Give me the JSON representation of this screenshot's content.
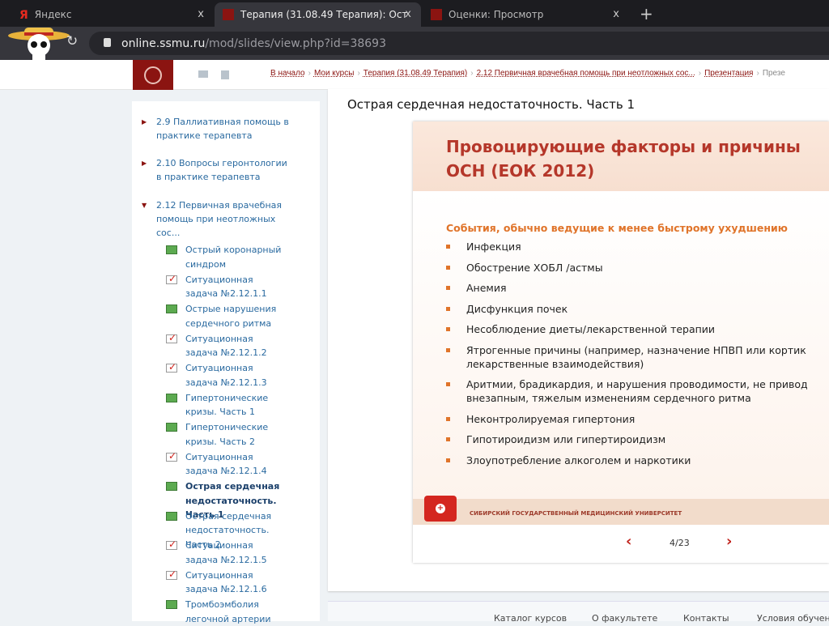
{
  "browser": {
    "tabs": [
      {
        "label": "Яндекс",
        "active": false,
        "icon": "yandex-icon"
      },
      {
        "label": "Терапия (31.08.49 Терапия): Ост",
        "active": true,
        "icon": "ssmu-icon"
      },
      {
        "label": "Оценки: Просмотр",
        "active": false,
        "icon": "ssmu-icon"
      }
    ],
    "close_glyph": "x",
    "new_tab": "+",
    "url_host": "online.ssmu.ru",
    "url_path": "/mod/slides/view.php?id=38693"
  },
  "breadcrumbs": [
    "В начало",
    "Мои курсы",
    "Терапия (31.08.49 Терапия)",
    "2.12 Первичная врачебная помощь при неотложных сос...",
    "Презентация",
    "Презе"
  ],
  "sidebar": {
    "sections": [
      {
        "label": "2.9 Паллиативная помощь в практике терапевта",
        "expanded": false
      },
      {
        "label": "2.10 Вопросы геронтологии в практике терапевта",
        "expanded": false
      },
      {
        "label": "2.12 Первичная врачебная помощь при неотложных сос...",
        "expanded": true
      }
    ],
    "items": [
      {
        "label": "Острый коронарный синдром",
        "type": "slides"
      },
      {
        "label": "Ситуационная задача №2.12.1.1",
        "type": "task"
      },
      {
        "label": "Острые нарушения сердечного ритма",
        "type": "slides"
      },
      {
        "label": "Ситуационная задача №2.12.1.2",
        "type": "task"
      },
      {
        "label": "Ситуационная задача №2.12.1.3",
        "type": "task"
      },
      {
        "label": "Гипертонические кризы. Часть 1",
        "type": "slides"
      },
      {
        "label": "Гипертонические кризы. Часть 2",
        "type": "slides"
      },
      {
        "label": "Ситуационная задача №2.12.1.4",
        "type": "task"
      },
      {
        "label": "Острая сердечная недостаточность. Часть 1",
        "type": "slides",
        "current": true
      },
      {
        "label": "Острая сердечная недостаточность. Часть 2",
        "type": "slides"
      },
      {
        "label": "Ситуационная задача №2.12.1.5",
        "type": "task"
      },
      {
        "label": "Ситуационная задача №2.12.1.6",
        "type": "task"
      },
      {
        "label": "Тромбоэмболия легочной артерии",
        "type": "slides"
      }
    ]
  },
  "main": {
    "title": "Острая сердечная недостаточность. Часть 1",
    "slide": {
      "heading_line1": "Провоцирующие факторы и причины",
      "heading_line2": "ОСН (ЕОК 2012)",
      "lead": "События, обычно ведущие к менее быстрому ухудшению",
      "bullets": [
        "Инфекция",
        "Обострение ХОБЛ /астмы",
        "Анемия",
        "Дисфункция почек",
        "Несоблюдение диеты/лекарственной терапии",
        "Ятрогенные причины (например, назначение НПВП или кортик\nлекарственные взаимодействия)",
        "Аритмии, брадикардия, и нарушения проводимости, не привод\nвнезапным, тяжелым изменениям сердечного ритма",
        "Неконтролируемая гипертония",
        "Гипотироидизм или гипертироидизм",
        "Злоупотребление алкоголем и наркотики"
      ],
      "footer_text": "СИБИРСКИЙ ГОСУДАРСТВЕННЫЙ МЕДИЦИНСКИЙ УНИВЕРСИТЕТ"
    },
    "pager": {
      "prev": "‹",
      "next": "›",
      "page": "4/23",
      "current": 4,
      "total": 23
    }
  },
  "footer": [
    "Каталог курсов",
    "О факультете",
    "Контакты",
    "Условия обучения"
  ],
  "colors": {
    "brand": "#8b1411",
    "link": "#2a6aa0",
    "accent": "#e0742a"
  }
}
